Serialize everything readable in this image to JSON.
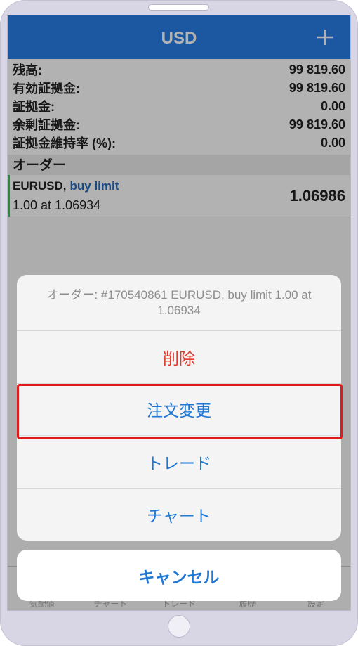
{
  "header": {
    "title": "USD",
    "add_icon": "plus-icon"
  },
  "account": {
    "rows": [
      {
        "label": "残高:",
        "value": "99 819.60"
      },
      {
        "label": "有効証拠金:",
        "value": "99 819.60"
      },
      {
        "label": "証拠金:",
        "value": "0.00"
      },
      {
        "label": "余剰証拠金:",
        "value": "99 819.60"
      },
      {
        "label": "証拠金維持率 (%):",
        "value": "0.00"
      }
    ]
  },
  "orders": {
    "section_title": "オーダー",
    "items": [
      {
        "symbol": "EURUSD,",
        "type": "buy limit",
        "detail": "1.00 at 1.06934",
        "price": "1.06986"
      }
    ]
  },
  "tab_bar": {
    "tabs": [
      "気配値",
      "チャート",
      "トレード",
      "履歴",
      "設定"
    ]
  },
  "action_sheet": {
    "title": "オーダー: #170540861 EURUSD, buy limit 1.00 at 1.06934",
    "actions": [
      {
        "label": "削除"
      },
      {
        "label": "注文変更"
      },
      {
        "label": "トレード"
      },
      {
        "label": "チャート"
      }
    ],
    "cancel_label": "キャンセル"
  },
  "colors": {
    "header_blue": "#287ee7",
    "buy_limit_blue": "#256abe",
    "action_blue": "#1e78d4",
    "destructive_red": "#e03b2e",
    "highlight_red": "#e11b1b",
    "order_accent_green": "#3cc35a"
  }
}
